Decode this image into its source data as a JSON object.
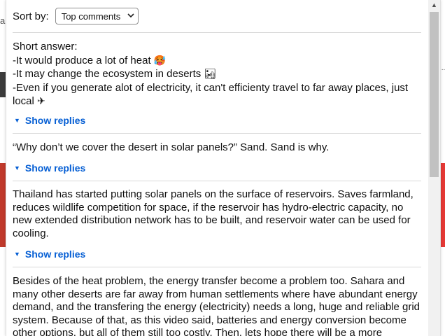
{
  "header": {
    "sort_label": "Sort by:",
    "sort_value": "Top comments"
  },
  "comments": [
    {
      "lines": [
        "Short answer:",
        "-It would produce a lot of heat",
        "-It may change the ecosystem in deserts",
        "-Even if you generate alot of electricity, it can't efficienty travel to far away places, just",
        "local"
      ],
      "emoji": [
        "🥵",
        "🏜",
        "✈"
      ],
      "replies_label": "Show replies"
    },
    {
      "text": "“Why don’t we cover the desert in solar panels?” Sand. Sand is why.",
      "replies_label": "Show replies"
    },
    {
      "text": "Thailand has started putting solar panels on the surface of reservoirs. Saves farmland, reduces wildlife competition for space, if the reservoir has hydro-electric capacity, no new extended distribution network has to be built, and reservoir water can be used for cooling.",
      "replies_label": "Show replies"
    },
    {
      "text": "Besides of the heat problem, the energy transfer become a problem too. Sahara and many other deserts are far away from human settlements where have abundant energy demand, and the transfering the energy (electricity) needs a long, huge and reliable grid system. Because of that, as this video said, batteries and energy conversion become other options, but all of them still too costly. Then, lets hope there will be a more"
    }
  ],
  "background": {
    "left_fragment": "a",
    "right_fragment": "..."
  }
}
